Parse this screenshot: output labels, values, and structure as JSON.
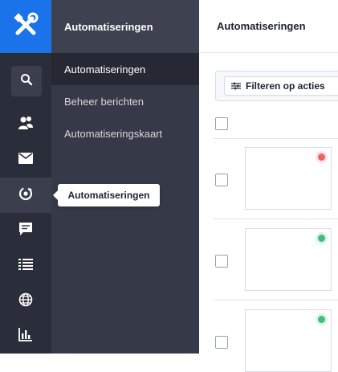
{
  "app": {
    "logo_icon": "tools-icon",
    "accent": "#1a73e8"
  },
  "rail": {
    "icons": [
      "search-icon",
      "contacts-icon",
      "mail-icon",
      "automation-icon",
      "chat-icon",
      "list-icon",
      "globe-icon",
      "chart-icon"
    ],
    "active": "automation-icon"
  },
  "subnav": {
    "title": "Automatiseringen",
    "items": [
      {
        "label": "Automatiseringen",
        "active": true
      },
      {
        "label": "Beheer berichten",
        "active": false
      },
      {
        "label": "Automatiseringskaart",
        "active": false
      }
    ]
  },
  "tooltip": {
    "text": "Automatiseringen"
  },
  "main": {
    "title": "Automatiseringen",
    "filter_label": "Filteren op acties",
    "rows": [
      {
        "status": "inactive",
        "status_color": "#e8666a"
      },
      {
        "status": "active",
        "status_color": "#3fbf7f"
      },
      {
        "status": "active",
        "status_color": "#3fbf7f"
      }
    ]
  }
}
